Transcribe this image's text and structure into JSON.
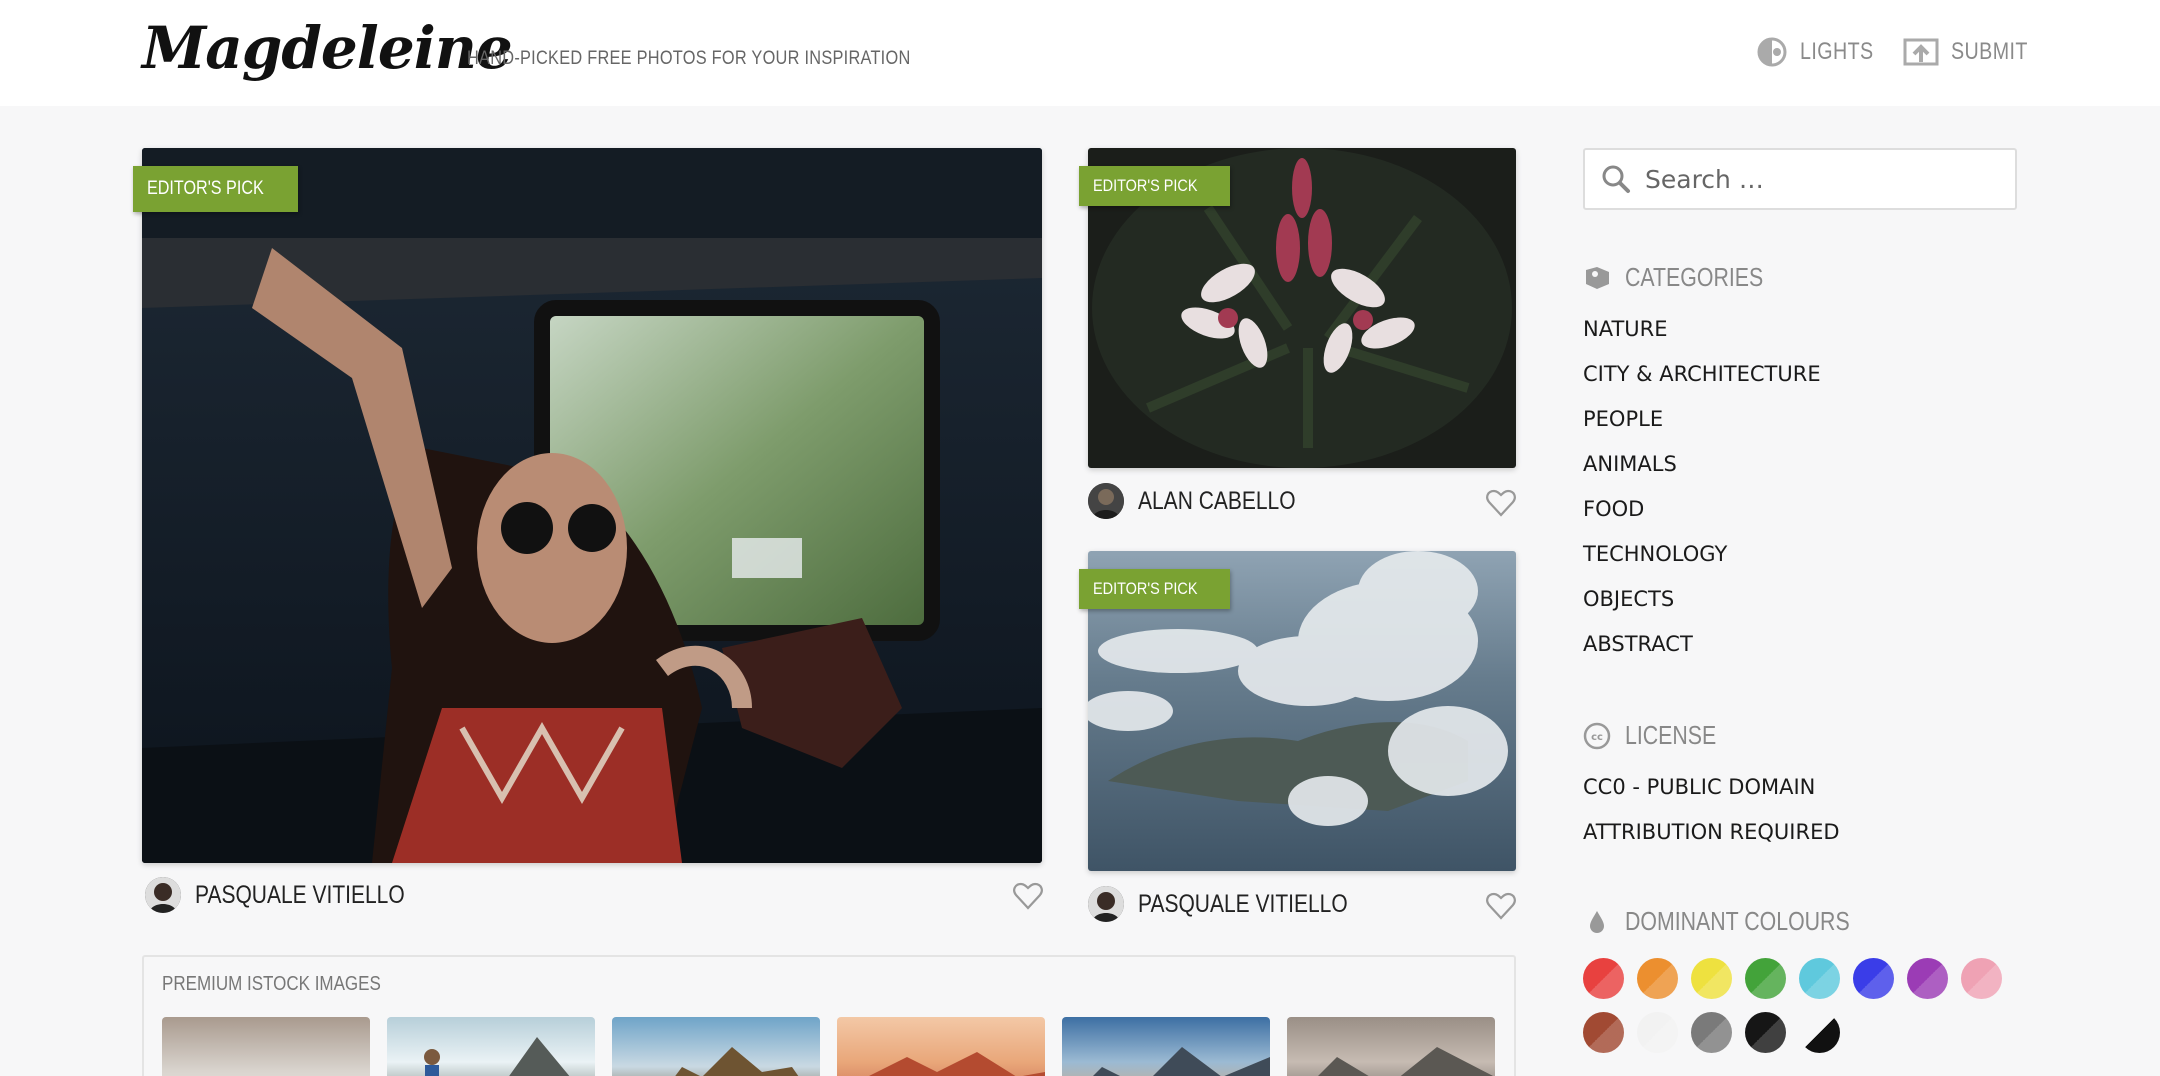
{
  "header": {
    "logo": "Magdeleine",
    "tagline": "HAND-PICKED FREE PHOTOS FOR YOUR INSPIRATION",
    "lights_label": "LIGHTS",
    "submit_label": "SUBMIT"
  },
  "photos": [
    {
      "badge": "EDITOR'S PICK",
      "author": "PASQUALE VITIELLO"
    },
    {
      "badge": "EDITOR'S PICK",
      "author": "ALAN CABELLO"
    },
    {
      "badge": "EDITOR'S PICK",
      "author": "PASQUALE VITIELLO"
    }
  ],
  "premium": {
    "title": "PREMIUM ISTOCK IMAGES"
  },
  "sidebar": {
    "search_placeholder": "Search …",
    "categories_title": "CATEGORIES",
    "categories": [
      "NATURE",
      "CITY & ARCHITECTURE",
      "PEOPLE",
      "ANIMALS",
      "FOOD",
      "TECHNOLOGY",
      "OBJECTS",
      "ABSTRACT"
    ],
    "license_title": "LICENSE",
    "licenses": [
      "CC0 - PUBLIC DOMAIN",
      "ATTRIBUTION REQUIRED"
    ],
    "colours_title": "DOMINANT COLOURS",
    "colours": [
      "#e8413f",
      "#ec8f2f",
      "#eee13f",
      "#43a33a",
      "#5fc9dd",
      "#3a3de8",
      "#9b3cb5",
      "#efa2b4",
      "#a14a33",
      "#f2f2f2",
      "#7a7a7a",
      "#161616",
      "#111111"
    ]
  }
}
